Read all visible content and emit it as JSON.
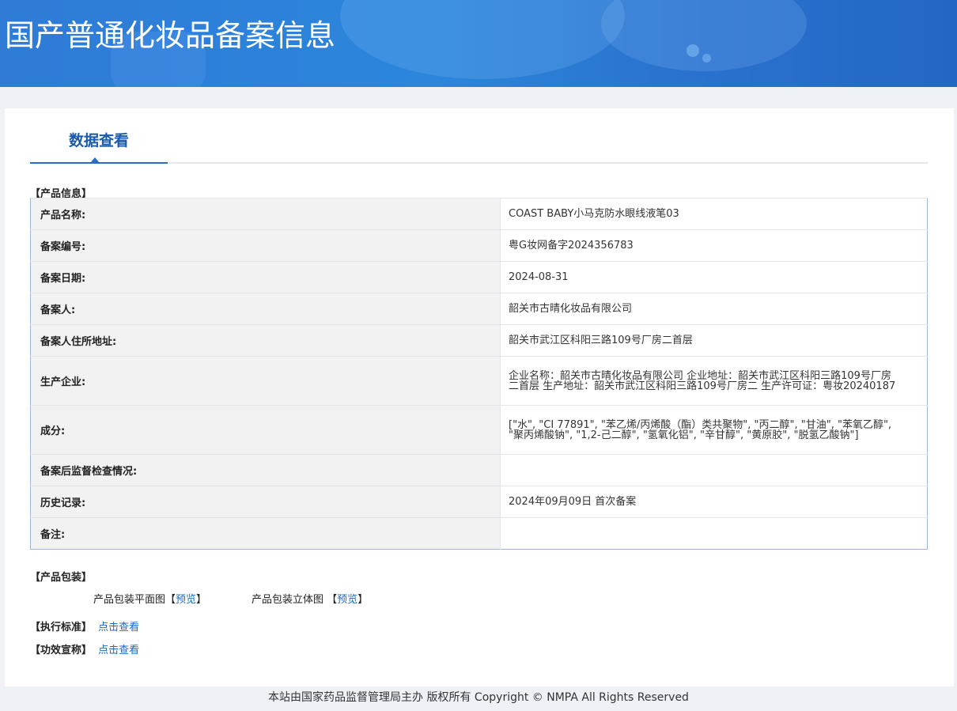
{
  "header": {
    "title": "国产普通化妆品备案信息"
  },
  "tab": {
    "label": "数据查看"
  },
  "product_section": {
    "title": "【产品信息】"
  },
  "rows": [
    {
      "label": "产品名称:",
      "value": "COAST BABY小马克防水眼线液笔03"
    },
    {
      "label": "备案编号:",
      "value": "粤G妆网备字2024356783"
    },
    {
      "label": "备案日期:",
      "value": "2024-08-31"
    },
    {
      "label": "备案人:",
      "value": "韶关市古晴化妆品有限公司"
    },
    {
      "label": "备案人住所地址:",
      "value": "韶关市武江区科阳三路109号厂房二首层"
    },
    {
      "label": "生产企业:",
      "value": "企业名称：韶关市古晴化妆品有限公司 企业地址：韶关市武江区科阳三路109号厂房二首层 生产地址：韶关市武江区科阳三路109号厂房二 生产许可证：粤妆20240187"
    },
    {
      "label": "成分:",
      "value": "[\"水\", \"CI 77891\", \"苯乙烯/丙烯酸（酯）类共聚物\", \"丙二醇\", \"甘油\", \"苯氧乙醇\", \"聚丙烯酸钠\", \"1,2-己二醇\", \"氢氧化铝\", \"辛甘醇\", \"黄原胶\", \"脱氢乙酸钠\"]"
    },
    {
      "label": "备案后监督检查情况:",
      "value": ""
    },
    {
      "label": "历史记录:",
      "value": "2024年09月09日 首次备案"
    },
    {
      "label": "备注:",
      "value": ""
    }
  ],
  "package_section": {
    "title": "【产品包装】",
    "flat_label": "产品包装平面图",
    "flat_link": "预览",
    "solid_label": "产品包装立体图",
    "solid_link": "预览",
    "bracket_open": "【",
    "bracket_close": "】"
  },
  "standard": {
    "title": "【执行标准】",
    "link": "点击查看"
  },
  "efficacy": {
    "title": "【功效宣称】",
    "link": "点击查看"
  },
  "footer": {
    "text": "本站由国家药品监督管理局主办 版权所有 Copyright © NMPA All Rights Reserved"
  }
}
